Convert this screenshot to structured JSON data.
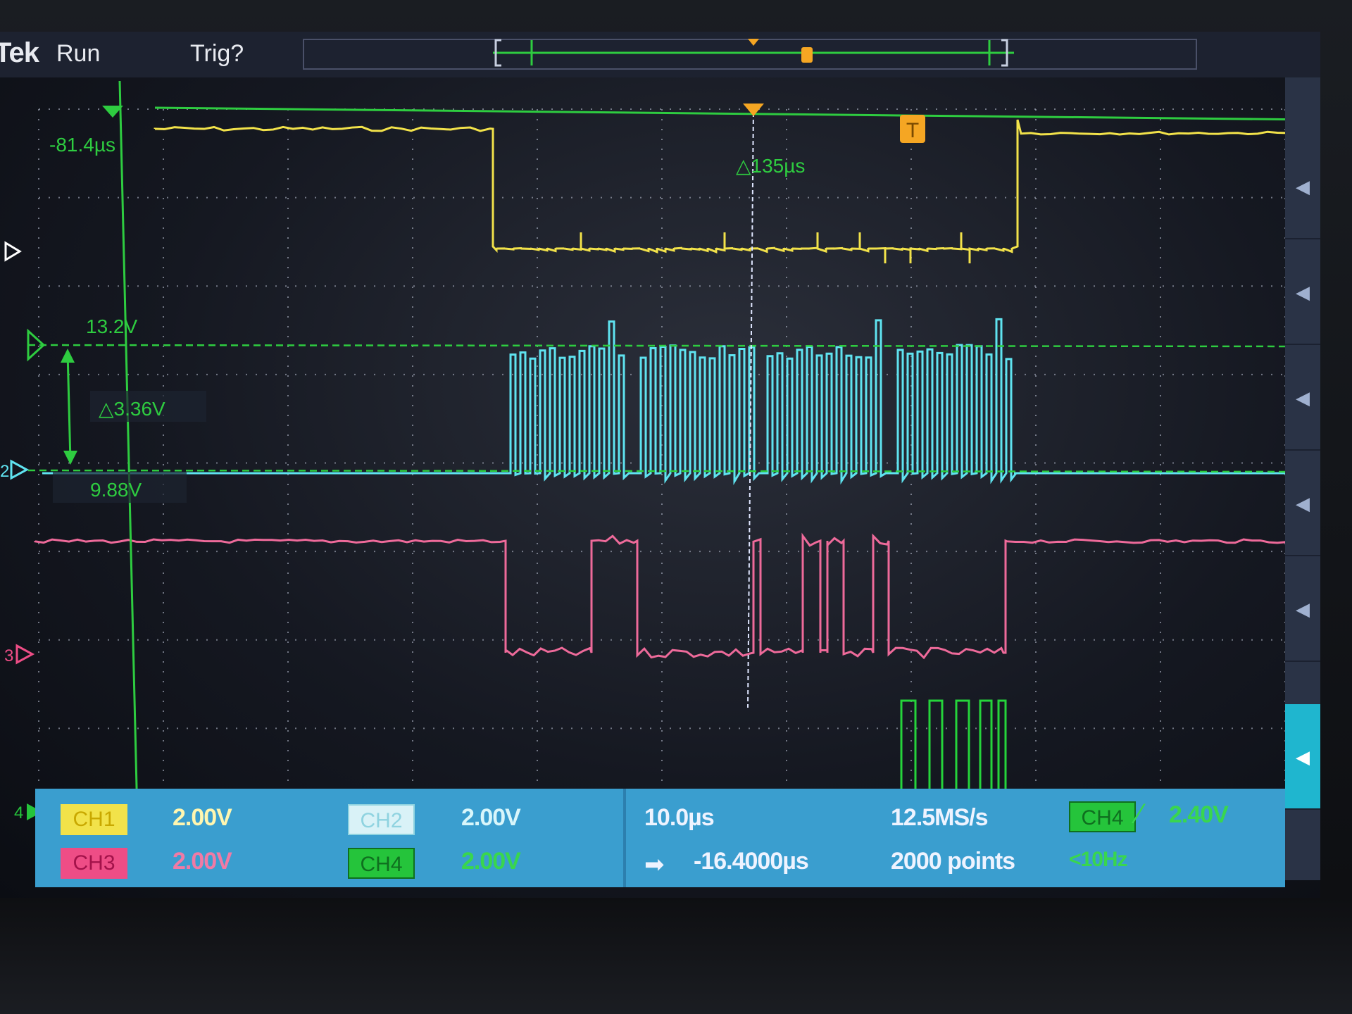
{
  "header": {
    "brand": "Tek",
    "run_state": "Run",
    "trigger_state": "Trig?"
  },
  "cursors": {
    "time_position": "-81.4µs",
    "time_delta": "△135µs",
    "voltage_upper": "13.2V",
    "voltage_delta": "△3.36V",
    "voltage_lower": "9.88V"
  },
  "channel_markers": {
    "ch2": "2",
    "ch3": "3",
    "ch4": "4",
    "trigger": "T"
  },
  "channels": [
    {
      "label": "CH1",
      "scale": "2.00V",
      "color": "#f2e24a"
    },
    {
      "label": "CH2",
      "scale": "2.00V",
      "color": "#5fe3f0"
    },
    {
      "label": "CH3",
      "scale": "2.00V",
      "color": "#ee4d86"
    },
    {
      "label": "CH4",
      "scale": "2.00V",
      "color": "#25c43b"
    }
  ],
  "horizontal": {
    "timebase": "10.0µs",
    "delay": "-16.4000µs",
    "sample_rate": "12.5MS/s",
    "record_length": "2000 points"
  },
  "trigger": {
    "source": "CH4",
    "level": "2.40V",
    "frequency": "<10Hz"
  },
  "colors": {
    "cursor": "#2ecc40",
    "grid": "#9aa0b0",
    "trigger_marker": "#f5a623"
  }
}
